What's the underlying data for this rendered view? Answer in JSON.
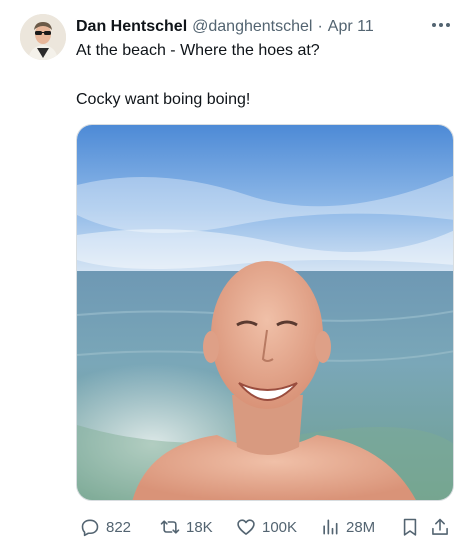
{
  "tweet": {
    "author_name": "Dan Hentschel",
    "author_handle": "@danghentschel",
    "separator": "·",
    "date": "Apr 11",
    "text_line_1": "At the beach - Where the hoes at?",
    "text_line_2": "Cocky want boing boing!"
  },
  "stats": {
    "replies": "822",
    "reposts": "18K",
    "likes": "100K",
    "views": "28M"
  },
  "icons": {
    "reply": "reply-icon",
    "repost": "repost-icon",
    "like": "heart-icon",
    "views": "views-icon",
    "bookmark": "bookmark-icon",
    "share": "share-icon",
    "more": "more-icon"
  },
  "colors": {
    "text": "#0f1419",
    "secondary": "#536471"
  }
}
